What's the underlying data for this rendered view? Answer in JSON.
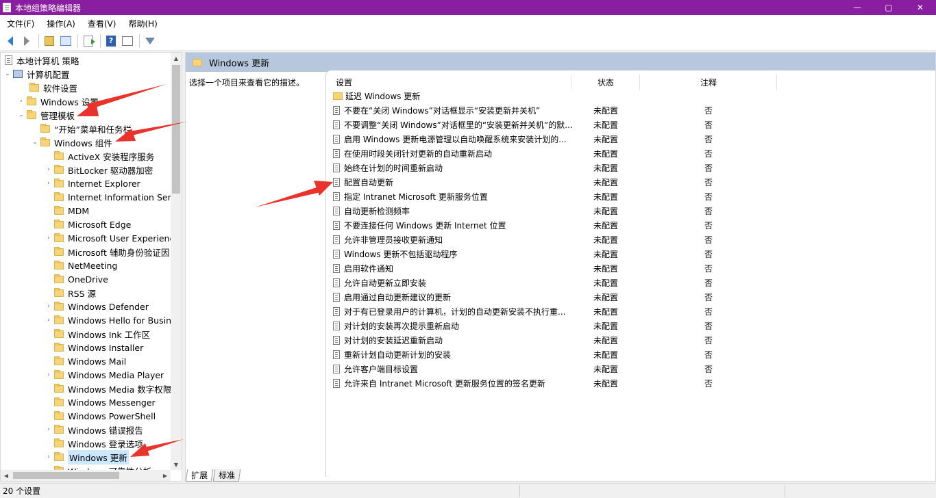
{
  "window": {
    "title": "本地组策略编辑器",
    "min": "—",
    "max": "▢",
    "close": "✕"
  },
  "menu": [
    "文件(F)",
    "操作(A)",
    "查看(V)",
    "帮助(H)"
  ],
  "toolbar": {
    "help_label": "?"
  },
  "tree": {
    "root": "本地计算机 策略",
    "computer_config": "计算机配置",
    "software_settings": "软件设置",
    "windows_settings": "Windows 设置",
    "admin_templates": "管理模板",
    "start_menu": "“开始”菜单和任务栏",
    "windows_components": "Windows 组件",
    "components": [
      {
        "label": "ActiveX 安装程序服务",
        "expand": false
      },
      {
        "label": "BitLocker 驱动器加密",
        "expand": true
      },
      {
        "label": "Internet Explorer",
        "expand": true
      },
      {
        "label": "Internet Information Serv",
        "expand": false
      },
      {
        "label": "MDM",
        "expand": false
      },
      {
        "label": "Microsoft Edge",
        "expand": false
      },
      {
        "label": "Microsoft User Experienc",
        "expand": true
      },
      {
        "label": "Microsoft 辅助身份验证因",
        "expand": false
      },
      {
        "label": "NetMeeting",
        "expand": false
      },
      {
        "label": "OneDrive",
        "expand": false
      },
      {
        "label": "RSS 源",
        "expand": false
      },
      {
        "label": "Windows Defender",
        "expand": true
      },
      {
        "label": "Windows Hello for Busine",
        "expand": true
      },
      {
        "label": "Windows Ink 工作区",
        "expand": false
      },
      {
        "label": "Windows Installer",
        "expand": false
      },
      {
        "label": "Windows Mail",
        "expand": false
      },
      {
        "label": "Windows Media Player",
        "expand": true
      },
      {
        "label": "Windows Media 数字权限",
        "expand": false
      },
      {
        "label": "Windows Messenger",
        "expand": false
      },
      {
        "label": "Windows PowerShell",
        "expand": false
      },
      {
        "label": "Windows 错误报告",
        "expand": true
      },
      {
        "label": "Windows 登录选项",
        "expand": false
      },
      {
        "label": "Windows 更新",
        "expand": true,
        "selected": true
      },
      {
        "label": "Windows 可靠性分析",
        "expand": false
      }
    ]
  },
  "right": {
    "header": "Windows 更新",
    "description": "选择一个项目来查看它的描述。",
    "columns": {
      "setting": "设置",
      "state": "状态",
      "note": "注释"
    },
    "folder_row": "延迟 Windows 更新",
    "rows": [
      {
        "name": "不要在“关闭 Windows”对话框显示“安装更新并关机”",
        "state": "未配置",
        "note": "否"
      },
      {
        "name": "不要调整“关闭 Windows”对话框里的“安装更新并关机”的默...",
        "state": "未配置",
        "note": "否"
      },
      {
        "name": "启用 Windows 更新电源管理以自动唤醒系统来安装计划的...",
        "state": "未配置",
        "note": "否"
      },
      {
        "name": "在使用时段关闭针对更新的自动重新启动",
        "state": "未配置",
        "note": "否"
      },
      {
        "name": "始终在计划的时间重新启动",
        "state": "未配置",
        "note": "否"
      },
      {
        "name": "配置自动更新",
        "state": "未配置",
        "note": "否"
      },
      {
        "name": "指定 Intranet Microsoft 更新服务位置",
        "state": "未配置",
        "note": "否"
      },
      {
        "name": "自动更新检测频率",
        "state": "未配置",
        "note": "否"
      },
      {
        "name": "不要连接任何 Windows 更新 Internet 位置",
        "state": "未配置",
        "note": "否"
      },
      {
        "name": "允许非管理员接收更新通知",
        "state": "未配置",
        "note": "否"
      },
      {
        "name": "Windows 更新不包括驱动程序",
        "state": "未配置",
        "note": "否"
      },
      {
        "name": "启用软件通知",
        "state": "未配置",
        "note": "否"
      },
      {
        "name": "允许自动更新立即安装",
        "state": "未配置",
        "note": "否"
      },
      {
        "name": "启用通过自动更新建议的更新",
        "state": "未配置",
        "note": "否"
      },
      {
        "name": "对于有已登录用户的计算机，计划的自动更新安装不执行重...",
        "state": "未配置",
        "note": "否"
      },
      {
        "name": "对计划的安装再次提示重新启动",
        "state": "未配置",
        "note": "否"
      },
      {
        "name": "对计划的安装延迟重新启动",
        "state": "未配置",
        "note": "否"
      },
      {
        "name": "重新计划自动更新计划的安装",
        "state": "未配置",
        "note": "否"
      },
      {
        "name": "允许客户端目标设置",
        "state": "未配置",
        "note": "否"
      },
      {
        "name": "允许来自 Intranet Microsoft 更新服务位置的签名更新",
        "state": "未配置",
        "note": "否"
      }
    ]
  },
  "tabs": [
    "扩展",
    "标准"
  ],
  "status": "20 个设置",
  "colors": {
    "titlebar": "#8a1ea0",
    "header": "#b7c7dd",
    "selection": "#cce8ff",
    "arrow": "#e8342c"
  }
}
